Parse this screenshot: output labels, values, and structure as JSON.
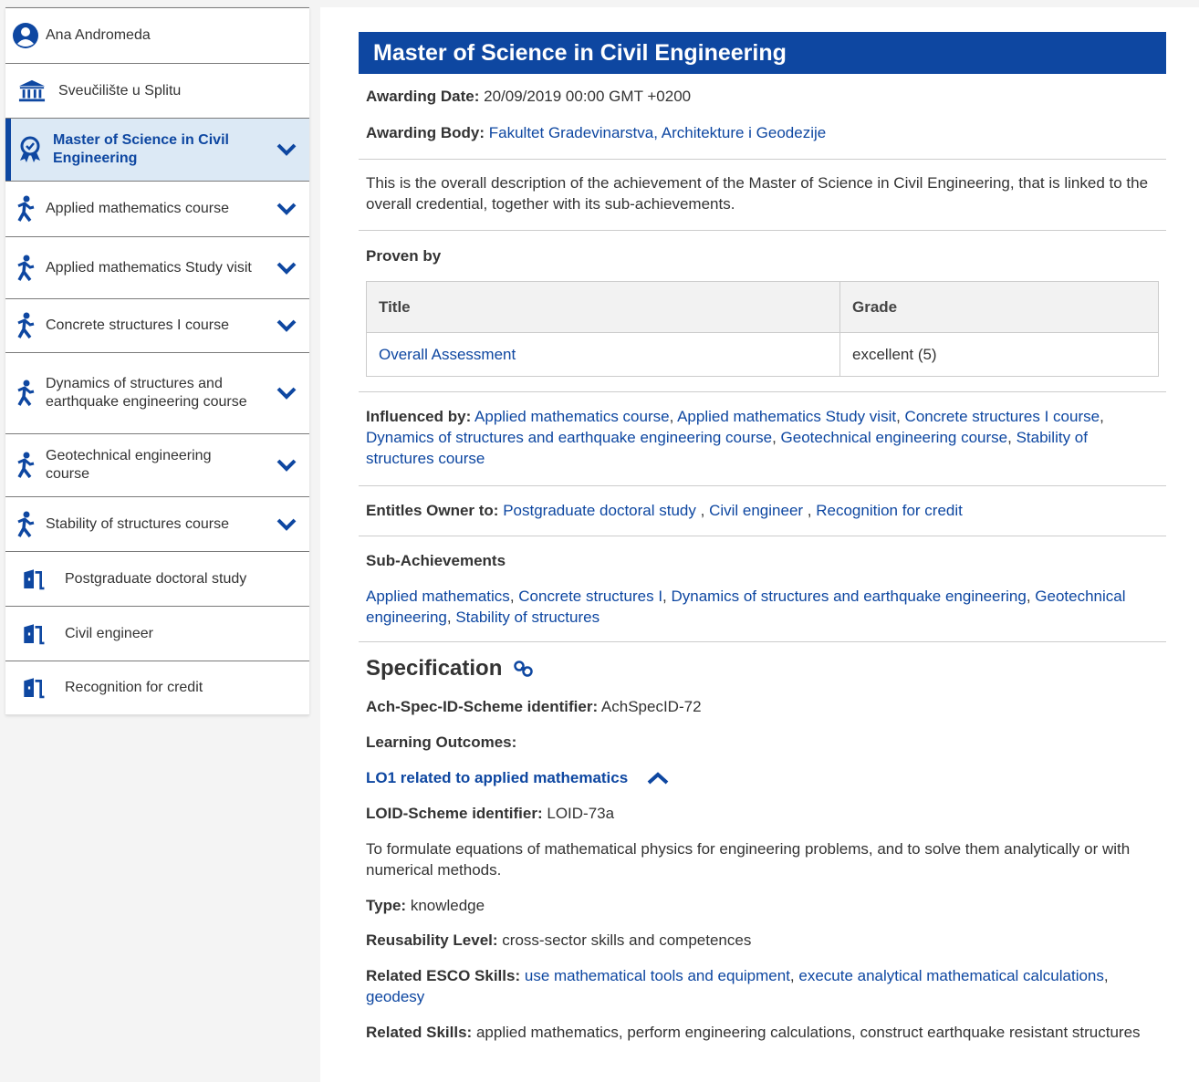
{
  "sidebar": {
    "items": [
      {
        "label": "Ana Andromeda",
        "icon": "person-circle-icon"
      },
      {
        "label": "Sveučilište u Splitu",
        "icon": "institution-icon"
      },
      {
        "label": "Master of Science in Civil Engineering",
        "icon": "award-badge-icon",
        "active": true
      },
      {
        "label": "Applied mathematics course",
        "icon": "activity-runner-icon"
      },
      {
        "label": "Applied mathematics Study visit",
        "icon": "activity-runner-icon"
      },
      {
        "label": "Concrete structures I course",
        "icon": "activity-runner-icon"
      },
      {
        "label": "Dynamics of structures and earthquake engineering course",
        "icon": "activity-runner-icon"
      },
      {
        "label": "Geotechnical engineering course",
        "icon": "activity-runner-icon"
      },
      {
        "label": "Stability of structures course",
        "icon": "activity-runner-icon"
      },
      {
        "label": "Postgraduate doctoral study",
        "icon": "door-exit-icon"
      },
      {
        "label": "Civil engineer",
        "icon": "door-exit-icon"
      },
      {
        "label": "Recognition for credit",
        "icon": "door-exit-icon"
      }
    ]
  },
  "main": {
    "title": "Master of Science in Civil Engineering",
    "awarding_date_label": "Awarding Date:",
    "awarding_date": "20/09/2019 00:00 GMT +0200",
    "awarding_body_label": "Awarding Body:",
    "awarding_body": "Fakultet Gradevinarstva, Architekture i Geodezije",
    "description": "This is the overall description of the achievement of the Master of Science in Civil Engineering, that is linked to the overall credential, together with its sub-achievements.",
    "proven_by_label": "Proven by",
    "table": {
      "headers": [
        "Title",
        "Grade"
      ],
      "rows": [
        [
          "Overall Assessment",
          "excellent (5)"
        ]
      ]
    },
    "influenced_by_label": "Influenced by:",
    "influenced_by": [
      "Applied mathematics course",
      "Applied mathematics Study visit",
      "Concrete structures I course",
      "Dynamics of structures and earthquake engineering course",
      "Geotechnical engineering course",
      "Stability of structures course"
    ],
    "entitles_label": "Entitles Owner to:",
    "entitles": [
      "Postgraduate doctoral study",
      "Civil engineer",
      "Recognition for credit"
    ],
    "sub_achievements_label": "Sub-Achievements",
    "sub_achievements": [
      "Applied mathematics",
      "Concrete structures I",
      "Dynamics of structures and earthquake engineering",
      "Geotechnical engineering",
      "Stability of structures"
    ],
    "specification_label": "Specification",
    "spec_id_label": "Ach-Spec-ID-Scheme identifier:",
    "spec_id": "AchSpecID-72",
    "learning_outcomes_label": "Learning Outcomes:",
    "lo_title": "LO1 related to applied mathematics",
    "loid_label": "LOID-Scheme identifier:",
    "loid": "LOID-73a",
    "lo_description": "To formulate equations of mathematical physics for engineering problems, and to solve them analytically or with numerical methods.",
    "type_label": "Type:",
    "type": "knowledge",
    "reusability_label": "Reusability Level:",
    "reusability": "cross-sector skills and competences",
    "esco_label": "Related ESCO Skills:",
    "esco_skills": [
      "use mathematical tools and equipment",
      "execute analytical mathematical calculations",
      "geodesy"
    ],
    "related_skills_label": "Related Skills:",
    "related_skills": "applied mathematics, perform engineering calculations, construct earthquake resistant structures"
  },
  "colors": {
    "accent": "#0e47a1",
    "active_bg": "#dce9f5"
  }
}
